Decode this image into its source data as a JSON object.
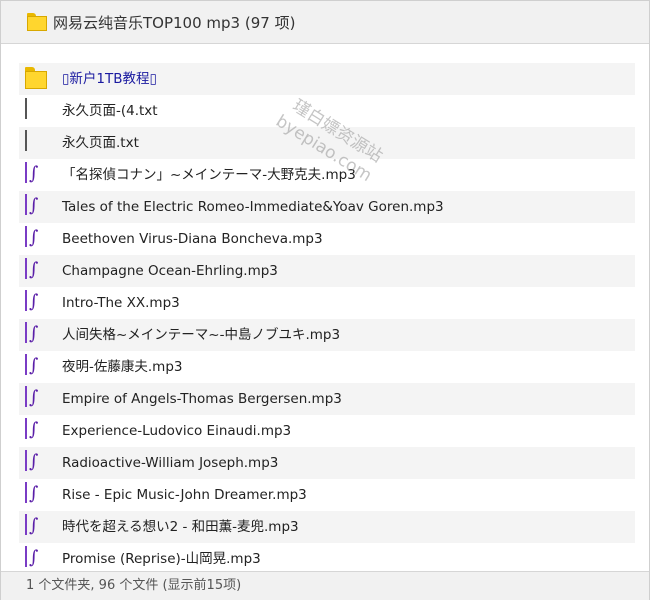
{
  "window": {
    "title": "网易云纯音乐TOP100 mp3 (97 项)"
  },
  "files": [
    {
      "name": "▯新户1TB教程▯",
      "type": "folder"
    },
    {
      "name": "永久页面-(4.txt",
      "type": "txt"
    },
    {
      "name": "永久页面.txt",
      "type": "txt"
    },
    {
      "name": "「名探偵コナン」~メインテーマ-大野克夫.mp3",
      "type": "mp3"
    },
    {
      "name": "Tales of the Electric Romeo-Immediate&Yoav Goren.mp3",
      "type": "mp3"
    },
    {
      "name": "Beethoven Virus-Diana Boncheva.mp3",
      "type": "mp3"
    },
    {
      "name": "Champagne Ocean-Ehrling.mp3",
      "type": "mp3"
    },
    {
      "name": "Intro-The XX.mp3",
      "type": "mp3"
    },
    {
      "name": "人间失格~メインテーマ~-中島ノブユキ.mp3",
      "type": "mp3"
    },
    {
      "name": "夜明-佐藤康夫.mp3",
      "type": "mp3"
    },
    {
      "name": "Empire of Angels-Thomas Bergersen.mp3",
      "type": "mp3"
    },
    {
      "name": "Experience-Ludovico Einaudi.mp3",
      "type": "mp3"
    },
    {
      "name": "Radioactive-William Joseph.mp3",
      "type": "mp3"
    },
    {
      "name": "Rise - Epic Music-John Dreamer.mp3",
      "type": "mp3"
    },
    {
      "name": "時代を超える想い2 - 和田薫-麦兜.mp3",
      "type": "mp3"
    },
    {
      "name": "Promise (Reprise)-山岡晃.mp3",
      "type": "mp3"
    }
  ],
  "status": {
    "text": "1 个文件夹, 96 个文件 (显示前15项)"
  },
  "watermark": {
    "line1": "瑾白嫖资源站",
    "line2": "byepiao.com"
  },
  "colors": {
    "folder": "#ffd62e",
    "mp3_icon": "#7a3cc5",
    "link_text": "#1a1aa0",
    "row_alt": "#f4f4f4"
  }
}
